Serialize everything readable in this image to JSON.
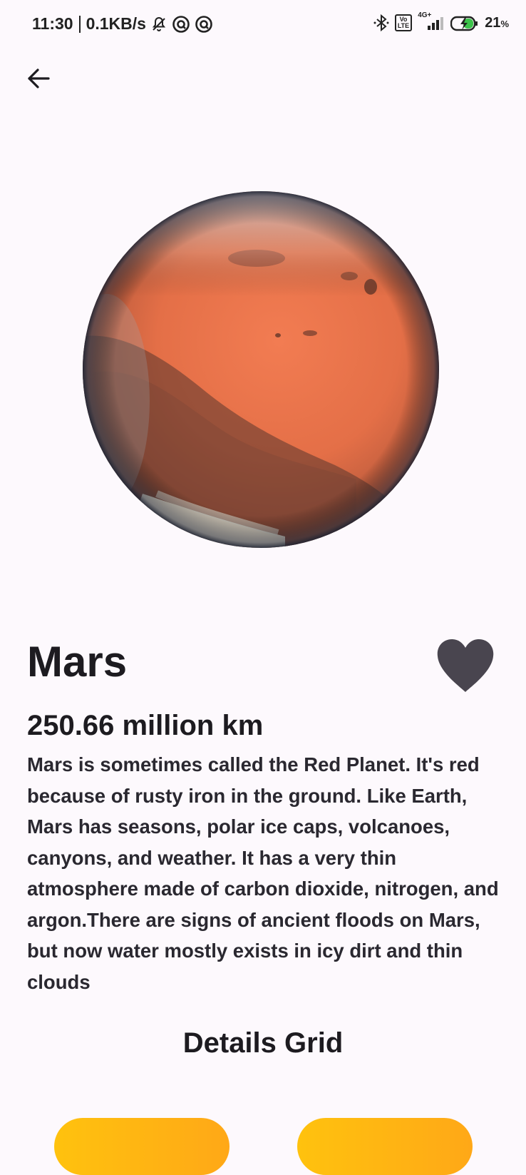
{
  "status_bar": {
    "time": "11:30",
    "network_speed": "0.1KB/s",
    "signal_label": "4G+",
    "volte_top": "Vo",
    "volte_bottom": "LTE",
    "battery_percent": "21",
    "battery_unit": "%"
  },
  "planet": {
    "name": "Mars",
    "distance": "250.66 million km",
    "description": "Mars is sometimes called the Red Planet. It's red because of rusty iron in the ground. Like Earth, Mars has seasons, polar ice caps, volcanoes, canyons, and weather. It has a very thin atmosphere made of carbon dioxide, nitrogen, and argon.There are signs of ancient floods on Mars, but now water mostly exists in icy dirt and thin clouds",
    "image_icon": "mars-planet-image"
  },
  "details": {
    "section_title": "Details Grid"
  },
  "icons": {
    "back": "arrow-left-icon",
    "favorite": "heart-icon"
  },
  "colors": {
    "background": "#fdf9fd",
    "heart": "#49454f",
    "card_gradient_start": "#ffc20e",
    "card_gradient_end": "#ffa817",
    "mars_orange": "#e8764e"
  }
}
